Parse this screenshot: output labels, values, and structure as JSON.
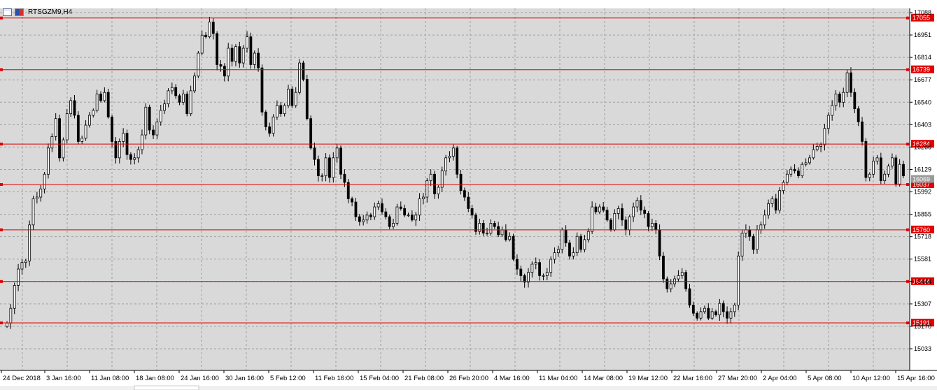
{
  "window": {
    "symbol_title": "RTSGZM9,H4",
    "icons": [
      "chart-window-icon",
      "flag-icon"
    ]
  },
  "colors": {
    "background": "#d9d9d9",
    "grid": "#a0a0a0",
    "level_line": "#e00000",
    "candle": "#000000",
    "current_price_bg": "#9a9a9a"
  },
  "chart_data": {
    "type": "candlestick",
    "title": "RTSGZM9,H4",
    "y_ticks": [
      17088,
      16951,
      16814,
      16677,
      16540,
      16403,
      16266,
      16129,
      15992,
      15855,
      15718,
      15581,
      15444,
      15307,
      15170,
      15033
    ],
    "ylim": [
      14900,
      17110
    ],
    "x_ticks": [
      "24 Dec 2018",
      "3 Jan 16:00",
      "11 Jan 08:00",
      "18 Jan 08:00",
      "24 Jan 16:00",
      "30 Jan 16:00",
      "5 Feb 12:00",
      "11 Feb 16:00",
      "15 Feb 04:00",
      "21 Feb 08:00",
      "26 Feb 20:00",
      "4 Mar 16:00",
      "11 Mar 04:00",
      "14 Mar 08:00",
      "19 Mar 12:00",
      "22 Mar 16:00",
      "27 Mar 20:00",
      "2 Apr 04:00",
      "5 Apr 08:00",
      "10 Apr 12:00",
      "15 Apr 16:00"
    ],
    "grid": true,
    "horizontal_levels": [
      17055,
      16739,
      16284,
      16037,
      15760,
      15444,
      15191
    ],
    "current_price": 16069,
    "closes": [
      15190,
      15280,
      15420,
      15520,
      15560,
      15570,
      15790,
      15950,
      15960,
      16010,
      16100,
      16260,
      16330,
      16440,
      16200,
      16310,
      16470,
      16550,
      16460,
      16300,
      16320,
      16400,
      16460,
      16490,
      16590,
      16550,
      16600,
      16450,
      16300,
      16200,
      16300,
      16350,
      16220,
      16190,
      16200,
      16250,
      16340,
      16510,
      16370,
      16340,
      16420,
      16490,
      16530,
      16610,
      16630,
      16580,
      16540,
      16590,
      16470,
      16610,
      16700,
      16840,
      16950,
      16940,
      17030,
      16960,
      16770,
      16760,
      16700,
      16870,
      16790,
      16880,
      16780,
      16870,
      16940,
      16770,
      16840,
      16750,
      16480,
      16390,
      16350,
      16450,
      16520,
      16470,
      16520,
      16620,
      16520,
      16600,
      16780,
      16680,
      16440,
      16260,
      16190,
      16090,
      16090,
      16200,
      16080,
      16200,
      16260,
      16100,
      16050,
      15950,
      15930,
      15840,
      15810,
      15820,
      15850,
      15840,
      15900,
      15920,
      15870,
      15840,
      15780,
      15800,
      15900,
      15890,
      15850,
      15850,
      15820,
      15850,
      15950,
      15960,
      16060,
      16100,
      15980,
      16020,
      16120,
      16200,
      16210,
      16260,
      16100,
      16000,
      15960,
      15890,
      15850,
      15750,
      15800,
      15740,
      15740,
      15800,
      15780,
      15730,
      15760,
      15700,
      15720,
      15580,
      15520,
      15480,
      15440,
      15500,
      15550,
      15560,
      15480,
      15480,
      15500,
      15580,
      15620,
      15640,
      15760,
      15680,
      15600,
      15620,
      15720,
      15640,
      15700,
      15750,
      15900,
      15870,
      15900,
      15880,
      15820,
      15760,
      15860,
      15890,
      15820,
      15760,
      15840,
      15900,
      15940,
      15880,
      15860,
      15780,
      15800,
      15760,
      15600,
      15460,
      15400,
      15430,
      15460,
      15480,
      15500,
      15400,
      15300,
      15250,
      15220,
      15260,
      15280,
      15220,
      15260,
      15240,
      15310,
      15260,
      15220,
      15260,
      15300,
      15600,
      15740,
      15760,
      15720,
      15640,
      15760,
      15790,
      15850,
      15920,
      15950,
      15880,
      16000,
      16050,
      16100,
      16130,
      16120,
      16090,
      16160,
      16170,
      16200,
      16250,
      16270,
      16280,
      16380,
      16460,
      16520,
      16590,
      16540,
      16600,
      16720,
      16600,
      16500,
      16420,
      16300,
      16080,
      16100,
      16180,
      16200,
      16060,
      16100,
      16150,
      16200,
      16040,
      16160,
      16090
    ]
  }
}
